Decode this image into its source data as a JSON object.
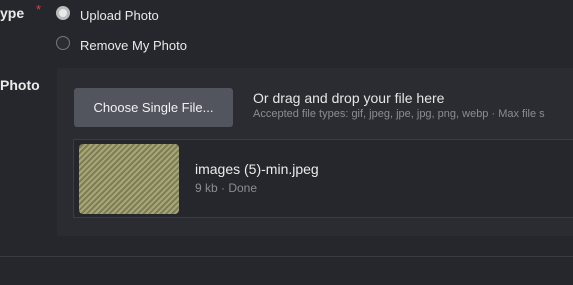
{
  "form": {
    "type_label": "ype",
    "required_mark": "*",
    "photo_label": "Photo"
  },
  "options": [
    {
      "label": "Upload Photo",
      "checked": true
    },
    {
      "label": "Remove My Photo",
      "checked": false
    }
  ],
  "upload": {
    "choose_button": "Choose Single File...",
    "drag_text": "Or drag and drop your file here",
    "accepted_text": "Accepted file types: gif, jpeg, jpe, jpg, png, webp · Max file s"
  },
  "file": {
    "name": "images (5)-min.jpeg",
    "meta": "9 kb · Done"
  }
}
